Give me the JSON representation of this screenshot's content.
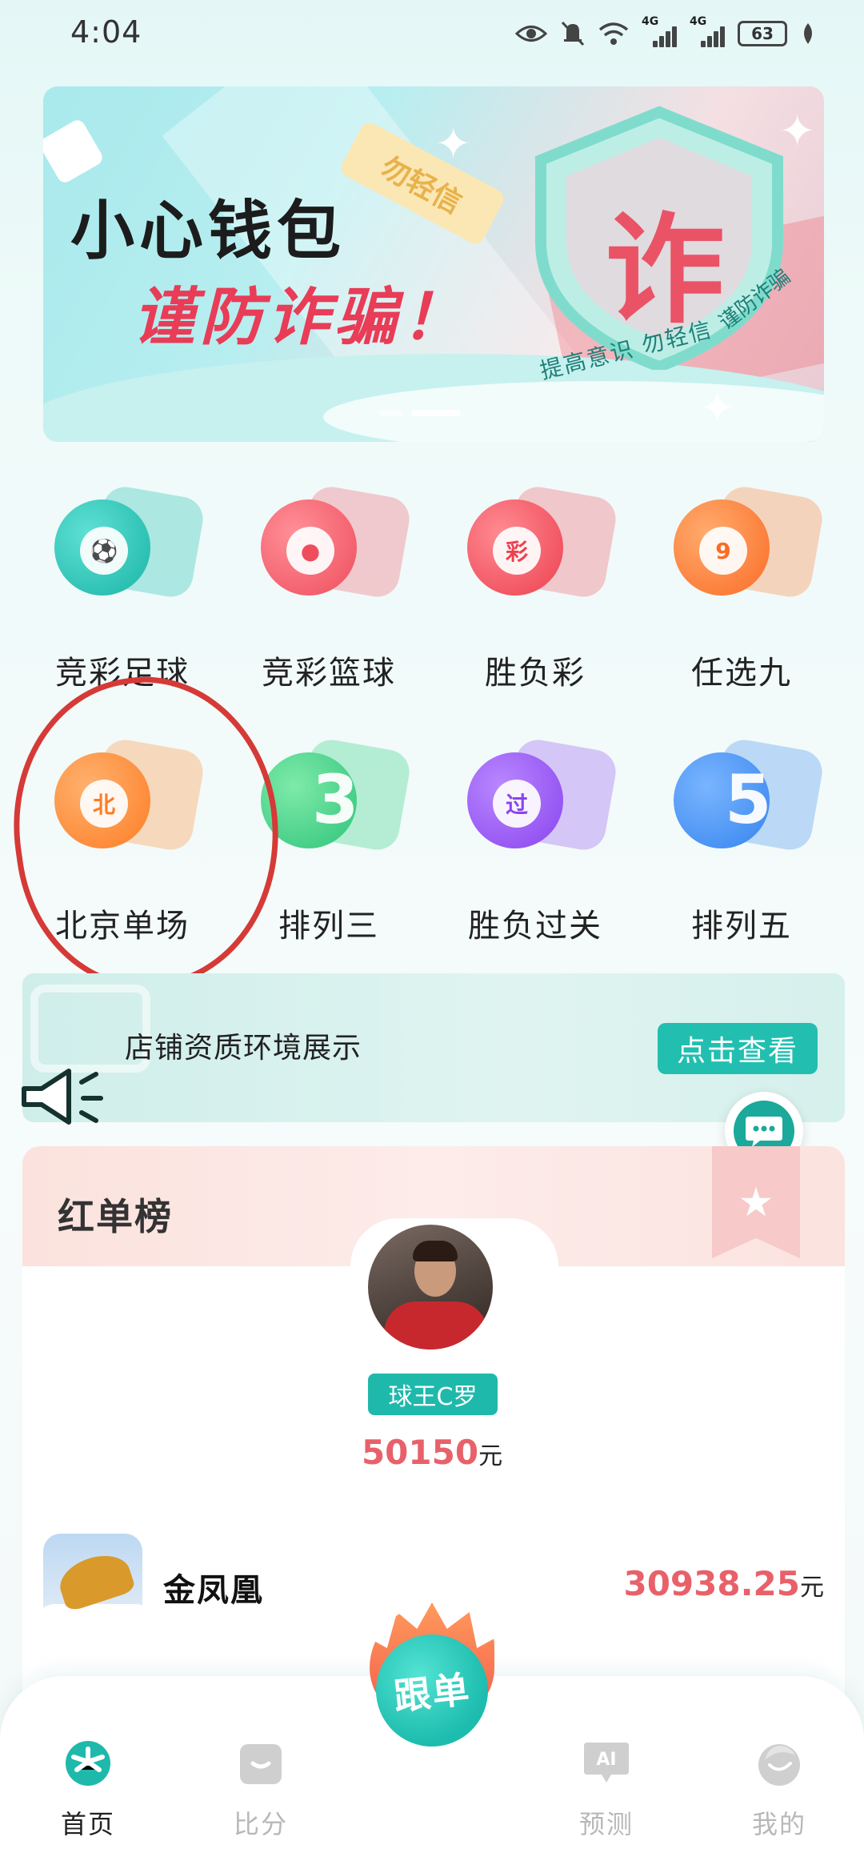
{
  "status_bar": {
    "time": "4:04",
    "battery": "63",
    "net1": "4G",
    "net2": "4G"
  },
  "banner": {
    "title_line1": "小心钱包",
    "title_line2": "谨防诈骗！",
    "tag": "勿轻信",
    "shield_char": "诈",
    "shield_caption": "提高意识  勿轻信",
    "shield_caption2": "谨防诈骗"
  },
  "lottery_items": [
    {
      "label": "竞彩足球",
      "color": "#2ec4b6",
      "glyph": "⚽"
    },
    {
      "label": "竞彩篮球",
      "color": "#f05a66",
      "glyph": "🏀"
    },
    {
      "label": "胜负彩",
      "color": "#f2545f",
      "glyph": "彩"
    },
    {
      "label": "任选九",
      "color": "#ff7a2f",
      "glyph": "9"
    },
    {
      "label": "北京单场",
      "color": "#ff8a30",
      "glyph": "北"
    },
    {
      "label": "排列三",
      "color": "#3ed38a",
      "glyph": "3"
    },
    {
      "label": "胜负过关",
      "color": "#8f4df0",
      "glyph": "过"
    },
    {
      "label": "排列五",
      "color": "#3a8cf0",
      "glyph": "5"
    }
  ],
  "notice": {
    "text": "店铺资质环境展示",
    "button": "点击查看"
  },
  "ranking": {
    "title": "红单榜",
    "top": {
      "name": "球王C罗",
      "amount": "50150",
      "unit": "元"
    },
    "rows": [
      {
        "name": "金凤凰",
        "amount": "30938.25",
        "unit": "元"
      }
    ]
  },
  "bottom_nav": {
    "items": [
      {
        "label": "首页",
        "active": true
      },
      {
        "label": "比分",
        "active": false
      },
      {
        "label": "预测",
        "active": false
      },
      {
        "label": "我的",
        "active": false
      }
    ],
    "center_label": "跟单",
    "ai_badge": "AI"
  },
  "colors": {
    "accent": "#22bfb0",
    "amount": "#e8616a",
    "annotation_circle": "#d53a37"
  }
}
